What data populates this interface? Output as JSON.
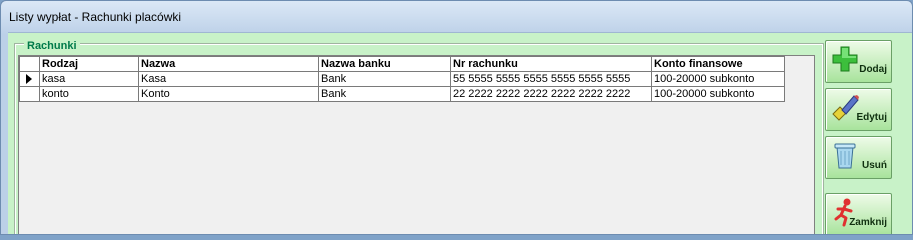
{
  "window": {
    "title": "Listy wypłat - Rachunki placówki"
  },
  "group": {
    "label": "Rachunki"
  },
  "table": {
    "columns": [
      "Rodzaj",
      "Nazwa",
      "Nazwa banku",
      "Nr rachunku",
      "Konto finansowe"
    ],
    "rows": [
      {
        "rodzaj": "kasa",
        "nazwa": "Kasa",
        "bank": "Bank",
        "nr": "55 5555 5555 5555 5555 5555 5555",
        "konto": "100-20000 subkonto"
      },
      {
        "rodzaj": "konto",
        "nazwa": "Konto",
        "bank": "Bank",
        "nr": "22 2222 2222 2222 2222 2222 2222",
        "konto": "100-20000 subkonto"
      }
    ]
  },
  "buttons": {
    "add": {
      "label": "Dodaj",
      "icon": "plus-icon"
    },
    "edit": {
      "label": "Edytuj",
      "icon": "pencil-eraser-icon"
    },
    "delete": {
      "label": "Usuń",
      "icon": "trash-icon"
    },
    "close": {
      "label": "Zamknij",
      "icon": "running-man-icon"
    }
  },
  "colors": {
    "client_bg": "#c8f2c8",
    "group_label": "#007a4a"
  }
}
